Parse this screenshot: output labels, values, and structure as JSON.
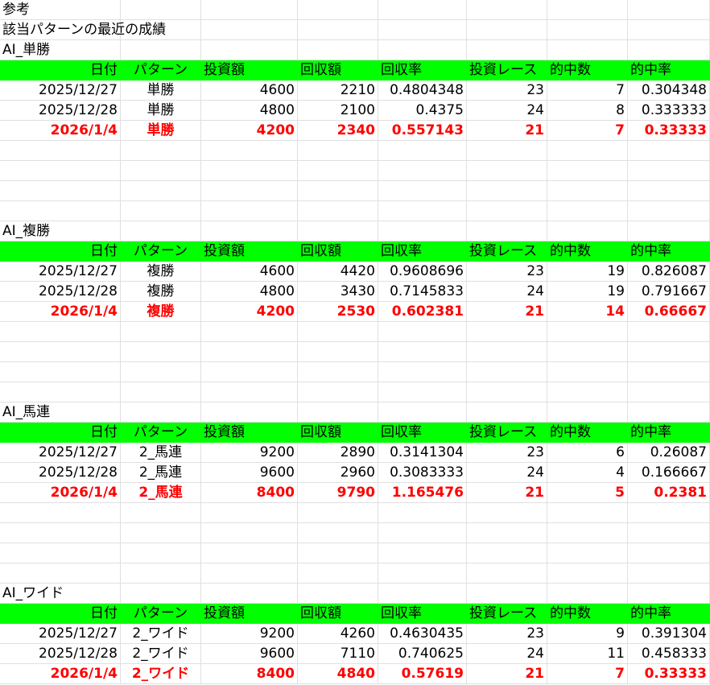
{
  "notes": [
    "参考",
    "該当パターンの最近の成績"
  ],
  "header": [
    "日付",
    "パターン",
    "投資額",
    "回収額",
    "回収率",
    "投資レース",
    "的中数",
    "的中率"
  ],
  "sections": [
    {
      "title": "AI_単勝",
      "rows": [
        [
          "2025/12/27",
          "単勝",
          "4600",
          "2210",
          "0.4804348",
          "23",
          "7",
          "0.304348"
        ],
        [
          "2025/12/28",
          "単勝",
          "4800",
          "2100",
          "0.4375",
          "24",
          "8",
          "0.333333"
        ],
        [
          "2026/1/4",
          "単勝",
          "4200",
          "2340",
          "0.557143",
          "21",
          "7",
          "0.33333"
        ]
      ]
    },
    {
      "title": "AI_複勝",
      "rows": [
        [
          "2025/12/27",
          "複勝",
          "4600",
          "4420",
          "0.9608696",
          "23",
          "19",
          "0.826087"
        ],
        [
          "2025/12/28",
          "複勝",
          "4800",
          "3430",
          "0.7145833",
          "24",
          "19",
          "0.791667"
        ],
        [
          "2026/1/4",
          "複勝",
          "4200",
          "2530",
          "0.602381",
          "21",
          "14",
          "0.66667"
        ]
      ]
    },
    {
      "title": "AI_馬連",
      "rows": [
        [
          "2025/12/27",
          "2_馬連",
          "9200",
          "2890",
          "0.3141304",
          "23",
          "6",
          "0.26087"
        ],
        [
          "2025/12/28",
          "2_馬連",
          "9600",
          "2960",
          "0.3083333",
          "24",
          "4",
          "0.166667"
        ],
        [
          "2026/1/4",
          "2_馬連",
          "8400",
          "9790",
          "1.165476",
          "21",
          "5",
          "0.2381"
        ]
      ]
    },
    {
      "title": "AI_ワイド",
      "rows": [
        [
          "2025/12/27",
          "2_ワイド",
          "9200",
          "4260",
          "0.4630435",
          "23",
          "9",
          "0.391304"
        ],
        [
          "2025/12/28",
          "2_ワイド",
          "9600",
          "7110",
          "0.740625",
          "24",
          "11",
          "0.458333"
        ],
        [
          "2026/1/4",
          "2_ワイド",
          "8400",
          "4840",
          "0.57619",
          "21",
          "7",
          "0.33333"
        ]
      ]
    }
  ]
}
